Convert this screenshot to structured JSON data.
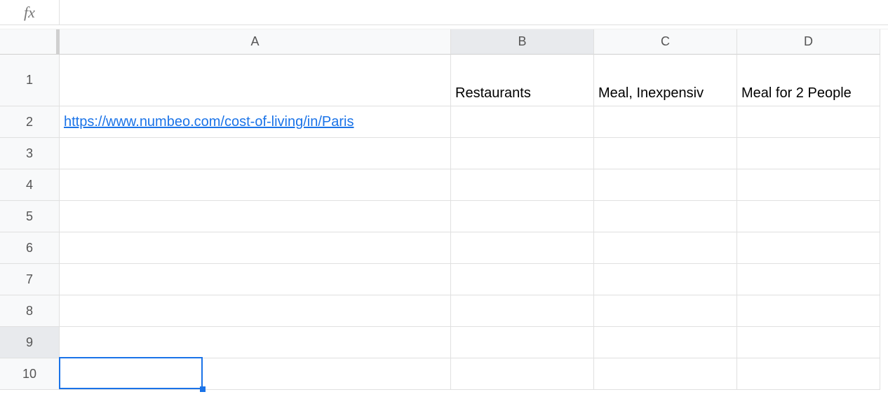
{
  "formula_bar": {
    "fx_label": "fx",
    "value": ""
  },
  "columns": [
    "A",
    "B",
    "C",
    "D"
  ],
  "rows": [
    "1",
    "2",
    "3",
    "4",
    "5",
    "6",
    "7",
    "8",
    "9",
    "10"
  ],
  "selected_cell": {
    "row": 9,
    "col": "B"
  },
  "cells": {
    "B1": "Restaurants",
    "C1": "Meal, Inexpensiv",
    "D1": "Meal for 2 People",
    "A2": "https://www.numbeo.com/cost-of-living/in/Paris"
  },
  "cell_types": {
    "A2": "link"
  }
}
